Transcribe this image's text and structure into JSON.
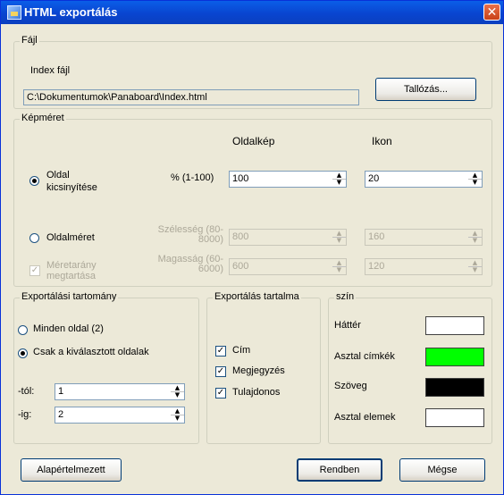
{
  "window": {
    "title": "HTML exportálás",
    "close_label": "✕"
  },
  "fajl": {
    "legend": "Fájl",
    "index_label": "Index fájl",
    "path": "C:\\Dokumentumok\\Panaboard\\Index.html",
    "browse_label": "Tallózás..."
  },
  "kepmeret": {
    "legend": "Képméret",
    "col_oldalkep": "Oldalkép",
    "col_ikon": "Ikon",
    "opt_kicsinyites": "Oldal kicsinyítése",
    "pct_label": "% (1-100)",
    "pct_oldalkep": "100",
    "pct_ikon": "20",
    "opt_oldalmeret": "Oldalméret",
    "szelesseg_label": "Szélesség (80-8000)",
    "szelesseg_oldalkep": "800",
    "szelesseg_ikon": "160",
    "arany_label": "Méretarány megtartása",
    "magassag_label": "Magasság (60-6000)",
    "magassag_oldalkep": "600",
    "magassag_ikon": "120"
  },
  "tartomany": {
    "legend": "Exportálási tartomány",
    "opt_minden": "Minden oldal (2)",
    "opt_kivalasztott": "Csak a kiválasztott oldalak",
    "tol_label": "-tól:",
    "tol_value": "1",
    "ig_label": "-ig:",
    "ig_value": "2"
  },
  "tartalma": {
    "legend": "Exportálás tartalma",
    "cim": "Cím",
    "megjegyzes": "Megjegyzés",
    "tulajdonos": "Tulajdonos"
  },
  "szin": {
    "legend": "szín",
    "hatter": "Háttér",
    "hatter_color": "#ffffff",
    "cimkek": "Asztal címkék",
    "cimkek_color": "#00ff00",
    "szoveg": "Szöveg",
    "szoveg_color": "#000000",
    "elemek": "Asztal elemek",
    "elemek_color": "#ffffff"
  },
  "buttons": {
    "alapertelmezett": "Alapértelmezett",
    "rendben": "Rendben",
    "megse": "Mégse"
  }
}
